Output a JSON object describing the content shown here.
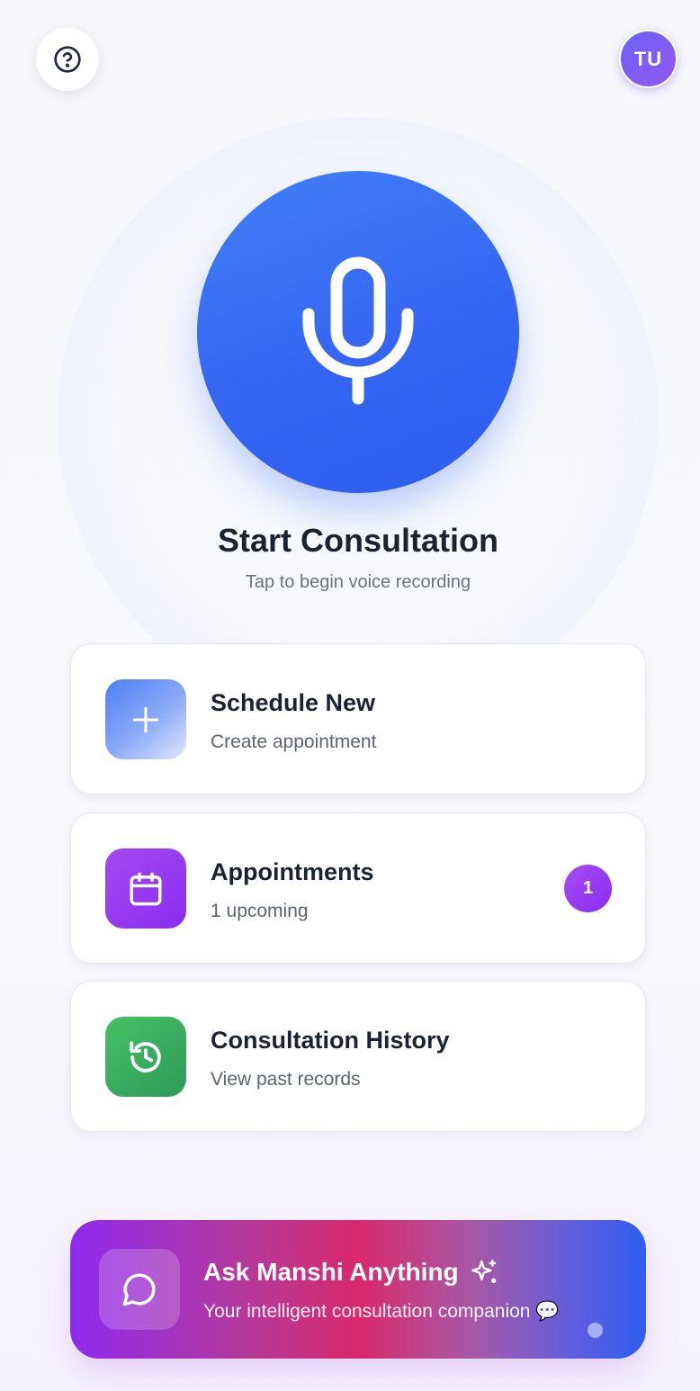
{
  "header": {
    "help_icon": "question-circle-icon",
    "avatar_initials": "TU"
  },
  "hero": {
    "mic_icon": "microphone-icon",
    "title": "Start Consultation",
    "subtitle": "Tap to begin voice recording"
  },
  "cards": [
    {
      "title": "Schedule New",
      "subtitle": "Create appointment",
      "icon": "plus-icon",
      "color": "#4d7ff6"
    },
    {
      "title": "Appointments",
      "subtitle": "1 upcoming",
      "icon": "calendar-icon",
      "color": "#9b3ef2",
      "badge": "1"
    },
    {
      "title": "Consultation History",
      "subtitle": "View past records",
      "icon": "history-icon",
      "color": "#3aab5f"
    }
  ],
  "ask": {
    "title": "Ask Manshi Anything",
    "subtitle": "Your intelligent consultation companion 💬",
    "icon": "chat-bubble-icon",
    "sparkle_icon": "sparkles-icon"
  },
  "colors": {
    "primary_blue": "#3565f2",
    "text_dark": "#1b2333",
    "text_muted": "#6b7280"
  }
}
